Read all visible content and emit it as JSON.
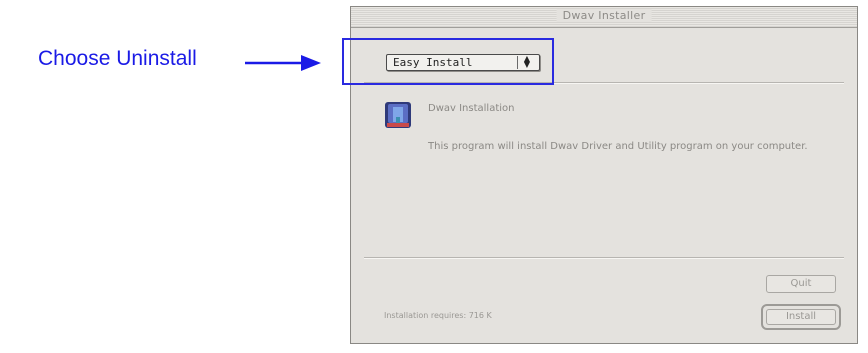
{
  "annotation": {
    "label": "Choose Uninstall",
    "color": "#1a1ae6"
  },
  "window": {
    "title": "Dwav Installer",
    "popup": {
      "selected": "Easy Install",
      "icon": "up-down-arrows-icon"
    },
    "heading": "Dwav Installation",
    "description": "This program will install Dwav Driver and Utility program on your computer.",
    "icon": "installer-app-icon",
    "requirement_label": "Installation requires: 716 K",
    "buttons": {
      "quit": "Quit",
      "install": "Install"
    }
  }
}
